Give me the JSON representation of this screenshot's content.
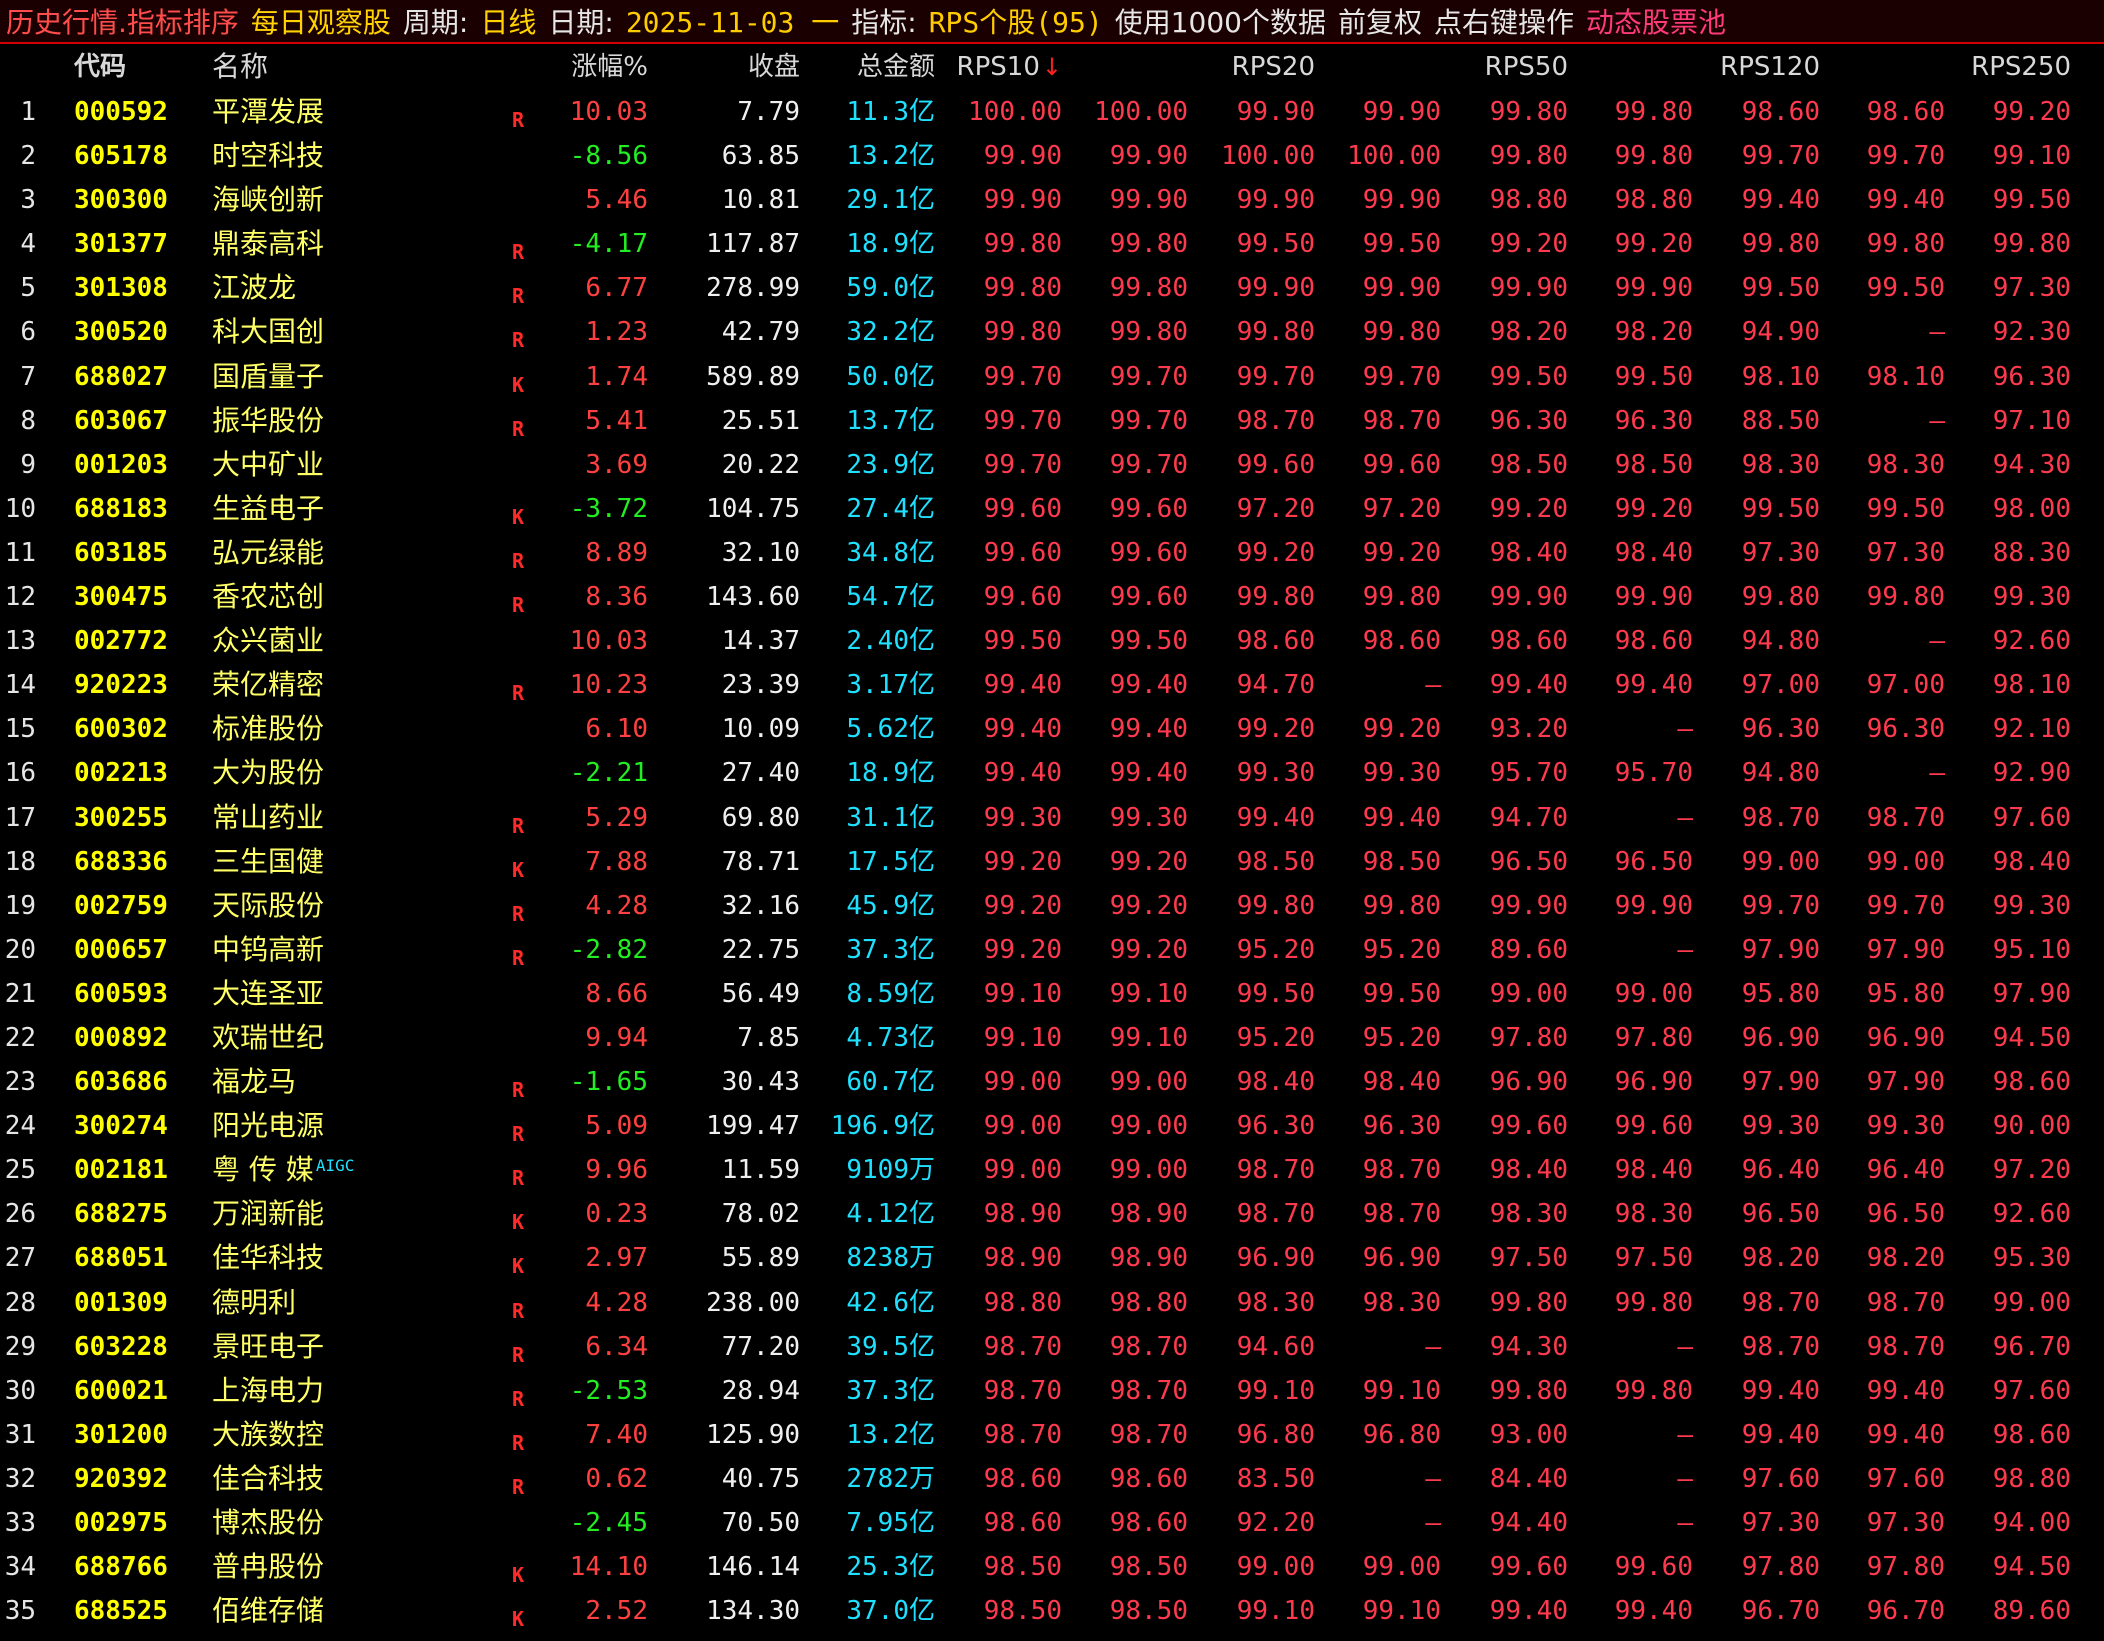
{
  "title_bar": {
    "segments": [
      {
        "text": "历史行情.指标排序",
        "style": "red"
      },
      {
        "text": "每日观察股",
        "style": "yellow"
      },
      {
        "text": "周期:",
        "style": "white"
      },
      {
        "text": "日线",
        "style": "yellow"
      },
      {
        "text": "日期:",
        "style": "white"
      },
      {
        "text": "2025-11-03 一",
        "style": "val"
      },
      {
        "text": "指标:",
        "style": "white"
      },
      {
        "text": "RPS个股(95)",
        "style": "val"
      },
      {
        "text": "使用1000个数据",
        "style": "white"
      },
      {
        "text": "前复权",
        "style": "white"
      },
      {
        "text": "点右键操作",
        "style": "white"
      },
      {
        "text": "动态股票池",
        "style": "magenta"
      }
    ]
  },
  "columns": {
    "code": "代码",
    "name": "名称",
    "pct": "涨幅%",
    "close": "收盘",
    "amount": "总金额",
    "rps10": "RPS10",
    "rps20": "RPS20",
    "rps50": "RPS50",
    "rps120": "RPS120",
    "rps250": "RPS250"
  },
  "colors": {
    "up": "#ff4040",
    "down": "#22ee22",
    "rps": "#ff3a4e",
    "amount": "#20e0ff",
    "code": "#ffff00"
  },
  "rows": [
    {
      "i": "1",
      "code": "000592",
      "name": "平潭发展",
      "tag": "R",
      "pct": "10.03",
      "close": "7.79",
      "amt": "11.3亿",
      "v": [
        "100.00",
        "100.00",
        "99.90",
        "99.90",
        "99.80",
        "99.80",
        "98.60",
        "98.60",
        "99.20"
      ]
    },
    {
      "i": "2",
      "code": "605178",
      "name": "时空科技",
      "tag": "",
      "pct": "-8.56",
      "close": "63.85",
      "amt": "13.2亿",
      "v": [
        "99.90",
        "99.90",
        "100.00",
        "100.00",
        "99.80",
        "99.80",
        "99.70",
        "99.70",
        "99.10"
      ]
    },
    {
      "i": "3",
      "code": "300300",
      "name": "海峡创新",
      "tag": "",
      "pct": "5.46",
      "close": "10.81",
      "amt": "29.1亿",
      "v": [
        "99.90",
        "99.90",
        "99.90",
        "99.90",
        "98.80",
        "98.80",
        "99.40",
        "99.40",
        "99.50"
      ]
    },
    {
      "i": "4",
      "code": "301377",
      "name": "鼎泰高科",
      "tag": "R",
      "pct": "-4.17",
      "close": "117.87",
      "amt": "18.9亿",
      "v": [
        "99.80",
        "99.80",
        "99.50",
        "99.50",
        "99.20",
        "99.20",
        "99.80",
        "99.80",
        "99.80"
      ]
    },
    {
      "i": "5",
      "code": "301308",
      "name": "江波龙",
      "tag": "R",
      "pct": "6.77",
      "close": "278.99",
      "amt": "59.0亿",
      "v": [
        "99.80",
        "99.80",
        "99.90",
        "99.90",
        "99.90",
        "99.90",
        "99.50",
        "99.50",
        "97.30"
      ]
    },
    {
      "i": "6",
      "code": "300520",
      "name": "科大国创",
      "tag": "R",
      "pct": "1.23",
      "close": "42.79",
      "amt": "32.2亿",
      "v": [
        "99.80",
        "99.80",
        "99.80",
        "99.80",
        "98.20",
        "98.20",
        "94.90",
        "—",
        "92.30"
      ]
    },
    {
      "i": "7",
      "code": "688027",
      "name": "国盾量子",
      "tag": "K",
      "pct": "1.74",
      "close": "589.89",
      "amt": "50.0亿",
      "v": [
        "99.70",
        "99.70",
        "99.70",
        "99.70",
        "99.50",
        "99.50",
        "98.10",
        "98.10",
        "96.30"
      ]
    },
    {
      "i": "8",
      "code": "603067",
      "name": "振华股份",
      "tag": "R",
      "pct": "5.41",
      "close": "25.51",
      "amt": "13.7亿",
      "v": [
        "99.70",
        "99.70",
        "98.70",
        "98.70",
        "96.30",
        "96.30",
        "88.50",
        "—",
        "97.10"
      ]
    },
    {
      "i": "9",
      "code": "001203",
      "name": "大中矿业",
      "tag": "",
      "pct": "3.69",
      "close": "20.22",
      "amt": "23.9亿",
      "v": [
        "99.70",
        "99.70",
        "99.60",
        "99.60",
        "98.50",
        "98.50",
        "98.30",
        "98.30",
        "94.30"
      ]
    },
    {
      "i": "10",
      "code": "688183",
      "name": "生益电子",
      "tag": "K",
      "pct": "-3.72",
      "close": "104.75",
      "amt": "27.4亿",
      "v": [
        "99.60",
        "99.60",
        "97.20",
        "97.20",
        "99.20",
        "99.20",
        "99.50",
        "99.50",
        "98.00"
      ]
    },
    {
      "i": "11",
      "code": "603185",
      "name": "弘元绿能",
      "tag": "R",
      "pct": "8.89",
      "close": "32.10",
      "amt": "34.8亿",
      "v": [
        "99.60",
        "99.60",
        "99.20",
        "99.20",
        "98.40",
        "98.40",
        "97.30",
        "97.30",
        "88.30"
      ]
    },
    {
      "i": "12",
      "code": "300475",
      "name": "香农芯创",
      "tag": "R",
      "pct": "8.36",
      "close": "143.60",
      "amt": "54.7亿",
      "v": [
        "99.60",
        "99.60",
        "99.80",
        "99.80",
        "99.90",
        "99.90",
        "99.80",
        "99.80",
        "99.30"
      ]
    },
    {
      "i": "13",
      "code": "002772",
      "name": "众兴菌业",
      "tag": "",
      "pct": "10.03",
      "close": "14.37",
      "amt": "2.40亿",
      "v": [
        "99.50",
        "99.50",
        "98.60",
        "98.60",
        "98.60",
        "98.60",
        "94.80",
        "—",
        "92.60"
      ]
    },
    {
      "i": "14",
      "code": "920223",
      "name": "荣亿精密",
      "tag": "R",
      "pct": "10.23",
      "close": "23.39",
      "amt": "3.17亿",
      "v": [
        "99.40",
        "99.40",
        "94.70",
        "—",
        "99.40",
        "99.40",
        "97.00",
        "97.00",
        "98.10"
      ]
    },
    {
      "i": "15",
      "code": "600302",
      "name": "标准股份",
      "tag": "",
      "pct": "6.10",
      "close": "10.09",
      "amt": "5.62亿",
      "v": [
        "99.40",
        "99.40",
        "99.20",
        "99.20",
        "93.20",
        "—",
        "96.30",
        "96.30",
        "92.10"
      ]
    },
    {
      "i": "16",
      "code": "002213",
      "name": "大为股份",
      "tag": "",
      "pct": "-2.21",
      "close": "27.40",
      "amt": "18.9亿",
      "v": [
        "99.40",
        "99.40",
        "99.30",
        "99.30",
        "95.70",
        "95.70",
        "94.80",
        "—",
        "92.90"
      ]
    },
    {
      "i": "17",
      "code": "300255",
      "name": "常山药业",
      "tag": "R",
      "pct": "5.29",
      "close": "69.80",
      "amt": "31.1亿",
      "v": [
        "99.30",
        "99.30",
        "99.40",
        "99.40",
        "94.70",
        "—",
        "98.70",
        "98.70",
        "97.60"
      ]
    },
    {
      "i": "18",
      "code": "688336",
      "name": "三生国健",
      "tag": "K",
      "pct": "7.88",
      "close": "78.71",
      "amt": "17.5亿",
      "v": [
        "99.20",
        "99.20",
        "98.50",
        "98.50",
        "96.50",
        "96.50",
        "99.00",
        "99.00",
        "98.40"
      ]
    },
    {
      "i": "19",
      "code": "002759",
      "name": "天际股份",
      "tag": "R",
      "pct": "4.28",
      "close": "32.16",
      "amt": "45.9亿",
      "v": [
        "99.20",
        "99.20",
        "99.80",
        "99.80",
        "99.90",
        "99.90",
        "99.70",
        "99.70",
        "99.30"
      ]
    },
    {
      "i": "20",
      "code": "000657",
      "name": "中钨高新",
      "tag": "R",
      "pct": "-2.82",
      "close": "22.75",
      "amt": "37.3亿",
      "v": [
        "99.20",
        "99.20",
        "95.20",
        "95.20",
        "89.60",
        "—",
        "97.90",
        "97.90",
        "95.10"
      ]
    },
    {
      "i": "21",
      "code": "600593",
      "name": "大连圣亚",
      "tag": "",
      "pct": "8.66",
      "close": "56.49",
      "amt": "8.59亿",
      "v": [
        "99.10",
        "99.10",
        "99.50",
        "99.50",
        "99.00",
        "99.00",
        "95.80",
        "95.80",
        "97.90"
      ]
    },
    {
      "i": "22",
      "code": "000892",
      "name": "欢瑞世纪",
      "tag": "",
      "pct": "9.94",
      "close": "7.85",
      "amt": "4.73亿",
      "v": [
        "99.10",
        "99.10",
        "95.20",
        "95.20",
        "97.80",
        "97.80",
        "96.90",
        "96.90",
        "94.50"
      ]
    },
    {
      "i": "23",
      "code": "603686",
      "name": "福龙马",
      "tag": "R",
      "pct": "-1.65",
      "close": "30.43",
      "amt": "60.7亿",
      "v": [
        "99.00",
        "99.00",
        "98.40",
        "98.40",
        "96.90",
        "96.90",
        "97.90",
        "97.90",
        "98.60"
      ]
    },
    {
      "i": "24",
      "code": "300274",
      "name": "阳光电源",
      "tag": "R",
      "pct": "5.09",
      "close": "199.47",
      "amt": "196.9亿",
      "v": [
        "99.00",
        "99.00",
        "96.30",
        "96.30",
        "99.60",
        "99.60",
        "99.30",
        "99.30",
        "90.00"
      ]
    },
    {
      "i": "25",
      "code": "002181",
      "name": "粤 传 媒",
      "aigc": "AIGC",
      "tag": "R",
      "pct": "9.96",
      "close": "11.59",
      "amt": "9109万",
      "v": [
        "99.00",
        "99.00",
        "98.70",
        "98.70",
        "98.40",
        "98.40",
        "96.40",
        "96.40",
        "97.20"
      ]
    },
    {
      "i": "26",
      "code": "688275",
      "name": "万润新能",
      "tag": "K",
      "pct": "0.23",
      "close": "78.02",
      "amt": "4.12亿",
      "v": [
        "98.90",
        "98.90",
        "98.70",
        "98.70",
        "98.30",
        "98.30",
        "96.50",
        "96.50",
        "92.60"
      ]
    },
    {
      "i": "27",
      "code": "688051",
      "name": "佳华科技",
      "tag": "K",
      "pct": "2.97",
      "close": "55.89",
      "amt": "8238万",
      "v": [
        "98.90",
        "98.90",
        "96.90",
        "96.90",
        "97.50",
        "97.50",
        "98.20",
        "98.20",
        "95.30"
      ]
    },
    {
      "i": "28",
      "code": "001309",
      "name": "德明利",
      "tag": "R",
      "pct": "4.28",
      "close": "238.00",
      "amt": "42.6亿",
      "v": [
        "98.80",
        "98.80",
        "98.30",
        "98.30",
        "99.80",
        "99.80",
        "98.70",
        "98.70",
        "99.00"
      ]
    },
    {
      "i": "29",
      "code": "603228",
      "name": "景旺电子",
      "tag": "R",
      "pct": "6.34",
      "close": "77.20",
      "amt": "39.5亿",
      "v": [
        "98.70",
        "98.70",
        "94.60",
        "—",
        "94.30",
        "—",
        "98.70",
        "98.70",
        "96.70"
      ]
    },
    {
      "i": "30",
      "code": "600021",
      "name": "上海电力",
      "tag": "R",
      "pct": "-2.53",
      "close": "28.94",
      "amt": "37.3亿",
      "v": [
        "98.70",
        "98.70",
        "99.10",
        "99.10",
        "99.80",
        "99.80",
        "99.40",
        "99.40",
        "97.60"
      ]
    },
    {
      "i": "31",
      "code": "301200",
      "name": "大族数控",
      "tag": "R",
      "pct": "7.40",
      "close": "125.90",
      "amt": "13.2亿",
      "v": [
        "98.70",
        "98.70",
        "96.80",
        "96.80",
        "93.00",
        "—",
        "99.40",
        "99.40",
        "98.60"
      ]
    },
    {
      "i": "32",
      "code": "920392",
      "name": "佳合科技",
      "tag": "R",
      "pct": "0.62",
      "close": "40.75",
      "amt": "2782万",
      "v": [
        "98.60",
        "98.60",
        "83.50",
        "—",
        "84.40",
        "—",
        "97.60",
        "97.60",
        "98.80"
      ]
    },
    {
      "i": "33",
      "code": "002975",
      "name": "博杰股份",
      "tag": "",
      "pct": "-2.45",
      "close": "70.50",
      "amt": "7.95亿",
      "v": [
        "98.60",
        "98.60",
        "92.20",
        "—",
        "94.40",
        "—",
        "97.30",
        "97.30",
        "94.00"
      ]
    },
    {
      "i": "34",
      "code": "688766",
      "name": "普冉股份",
      "tag": "K",
      "pct": "14.10",
      "close": "146.14",
      "amt": "25.3亿",
      "v": [
        "98.50",
        "98.50",
        "99.00",
        "99.00",
        "99.60",
        "99.60",
        "97.80",
        "97.80",
        "94.50"
      ]
    },
    {
      "i": "35",
      "code": "688525",
      "name": "佰维存储",
      "tag": "K",
      "pct": "2.52",
      "close": "134.30",
      "amt": "37.0亿",
      "v": [
        "98.50",
        "98.50",
        "99.10",
        "99.10",
        "99.40",
        "99.40",
        "96.70",
        "96.70",
        "89.60"
      ]
    }
  ]
}
